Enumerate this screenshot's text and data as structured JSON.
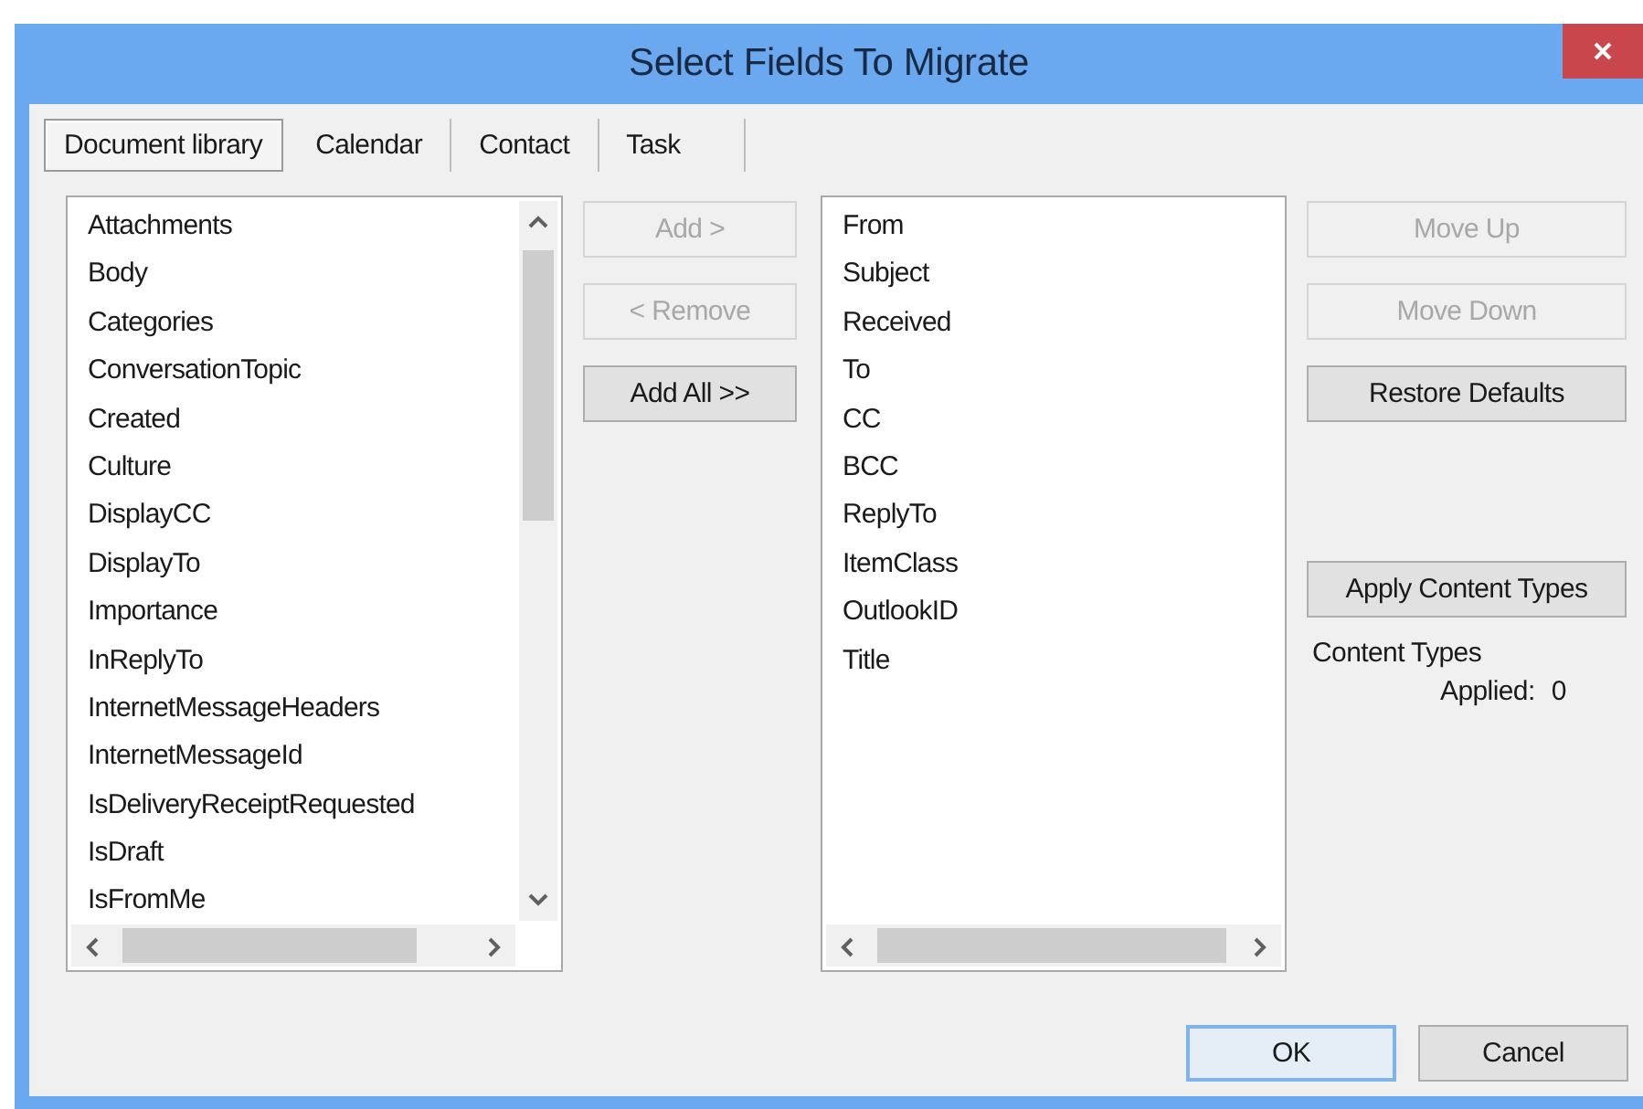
{
  "window": {
    "title": "Select Fields To Migrate"
  },
  "tabs": [
    {
      "label": "Document library",
      "selected": true
    },
    {
      "label": "Calendar",
      "selected": false
    },
    {
      "label": "Contact",
      "selected": false
    },
    {
      "label": "Task",
      "selected": false
    }
  ],
  "available_fields": [
    "Attachments",
    "Body",
    "Categories",
    "ConversationTopic",
    "Created",
    "Culture",
    "DisplayCC",
    "DisplayTo",
    "Importance",
    "InReplyTo",
    "InternetMessageHeaders",
    "InternetMessageId",
    "IsDeliveryReceiptRequested",
    "IsDraft",
    "IsFromMe"
  ],
  "transfer_buttons": [
    {
      "label": "Add >",
      "disabled": true
    },
    {
      "label": "< Remove",
      "disabled": true
    },
    {
      "label": "Add All >>",
      "disabled": false
    }
  ],
  "selected_fields": [
    "From",
    "Subject",
    "Received",
    "To",
    "CC",
    "BCC",
    "ReplyTo",
    "ItemClass",
    "OutlookID",
    "Title"
  ],
  "order_buttons": [
    {
      "label": "Move Up",
      "disabled": true
    },
    {
      "label": "Move Down",
      "disabled": true
    },
    {
      "label": "Restore Defaults",
      "disabled": false
    }
  ],
  "content_types_button": {
    "label": "Apply Content Types",
    "disabled": false
  },
  "content_types_label": "Content Types",
  "applied_label": "Applied:",
  "applied_value": "0",
  "footer_buttons": [
    {
      "label": "OK",
      "default": true
    },
    {
      "label": "Cancel",
      "default": false
    }
  ]
}
